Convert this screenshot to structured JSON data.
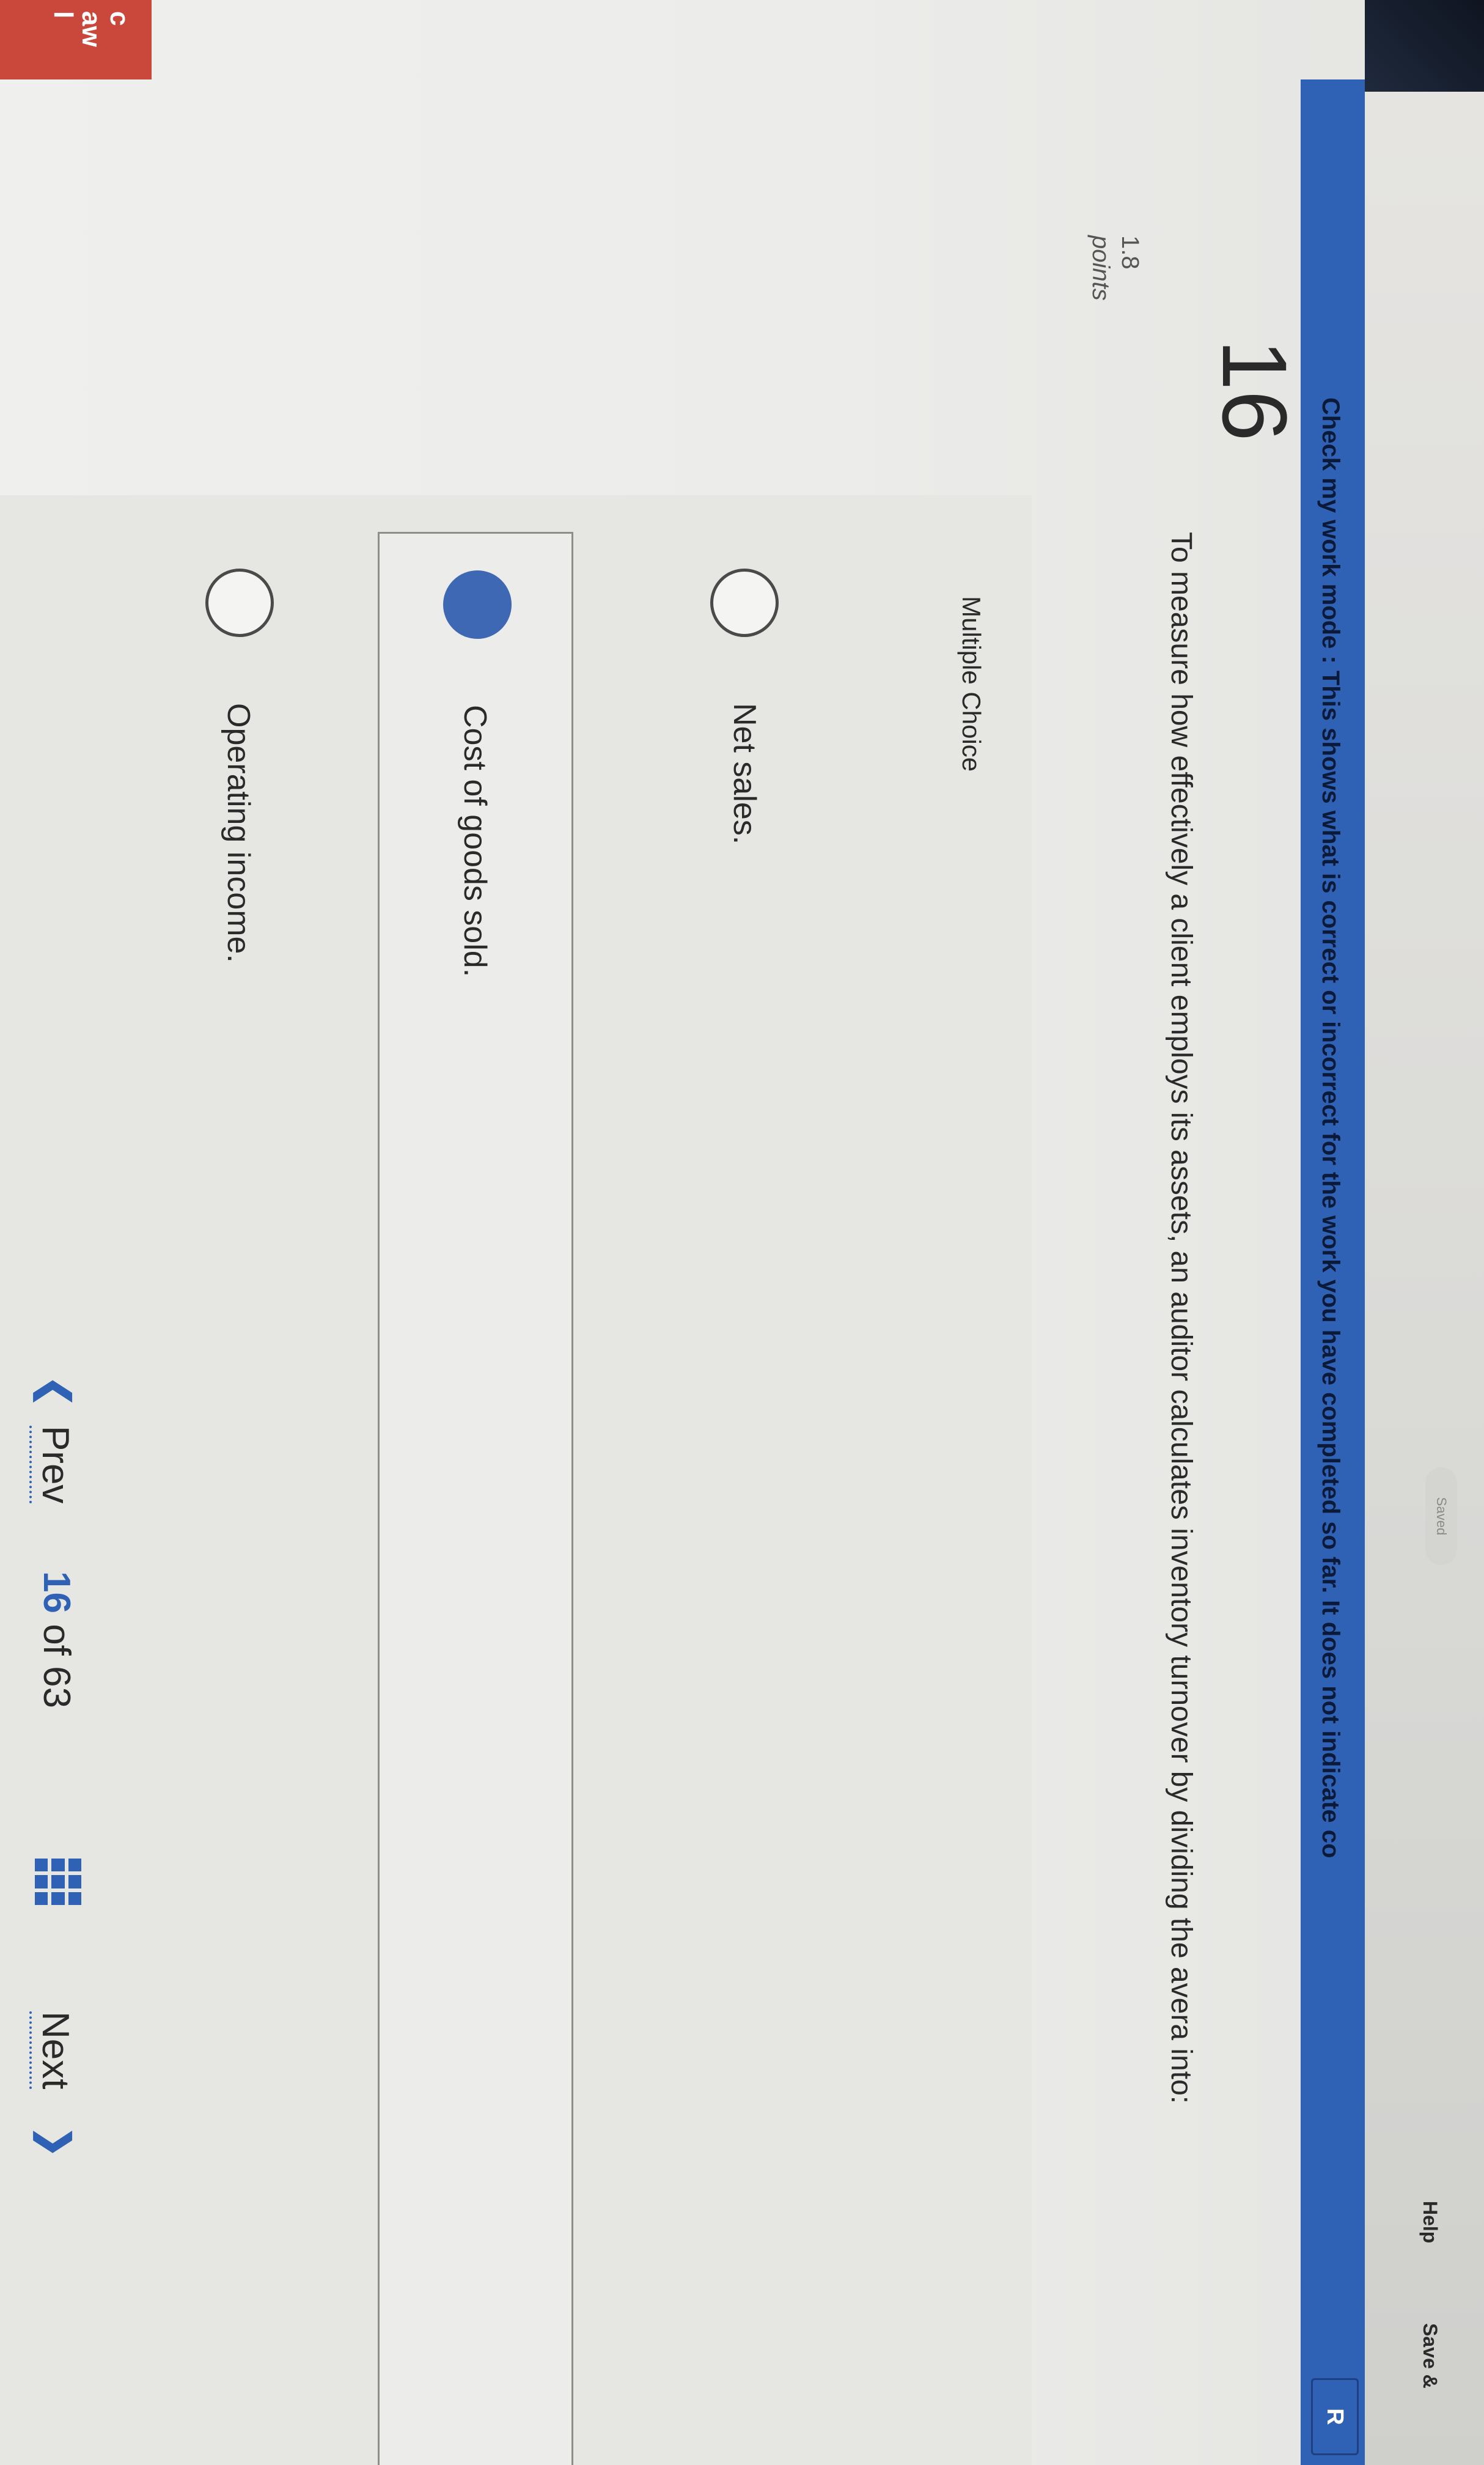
{
  "header": {
    "saved_label": "Saved",
    "help_label": "Help",
    "save_exit_label": "Save &"
  },
  "banner": {
    "text": "Check my work mode : This shows what is correct or incorrect for the work you have completed so far. It does not indicate co",
    "r_button_label": "R"
  },
  "logo": {
    "line1": "c",
    "line2": "aw",
    "line3": "l"
  },
  "question": {
    "number": "16",
    "points_value": "1.8",
    "points_unit": "points",
    "text": "To measure how effectively a client employs its assets, an auditor calculates inventory turnover by dividing the avera into:",
    "type_label": "Multiple Choice",
    "options": [
      {
        "label": "Net sales.",
        "selected": false
      },
      {
        "label": "Cost of goods sold.",
        "selected": true
      },
      {
        "label": "Operating income.",
        "selected": false
      }
    ]
  },
  "navigation": {
    "prev_label": "Prev",
    "current": "16",
    "of_label": "of",
    "total": "63",
    "next_label": "Next"
  },
  "colors": {
    "accent": "#2f61b5",
    "selected_radio": "#3e68b4",
    "logo": "#c9473b"
  },
  "icons": {
    "prev": "chevron-left-icon",
    "next": "chevron-right-icon",
    "question_map": "grid-icon"
  }
}
